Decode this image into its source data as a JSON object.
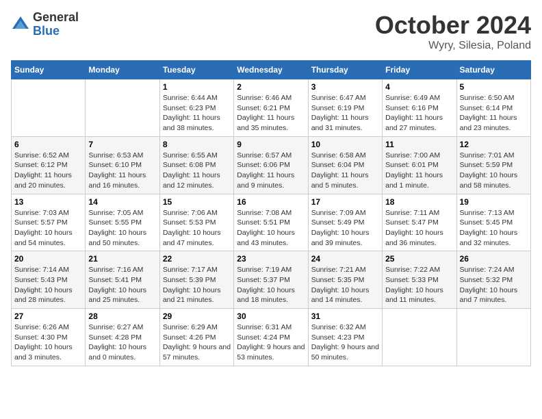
{
  "header": {
    "logo_general": "General",
    "logo_blue": "Blue",
    "month_title": "October 2024",
    "location": "Wyry, Silesia, Poland"
  },
  "weekdays": [
    "Sunday",
    "Monday",
    "Tuesday",
    "Wednesday",
    "Thursday",
    "Friday",
    "Saturday"
  ],
  "weeks": [
    [
      {
        "day": "",
        "detail": ""
      },
      {
        "day": "",
        "detail": ""
      },
      {
        "day": "1",
        "detail": "Sunrise: 6:44 AM\nSunset: 6:23 PM\nDaylight: 11 hours\nand 38 minutes."
      },
      {
        "day": "2",
        "detail": "Sunrise: 6:46 AM\nSunset: 6:21 PM\nDaylight: 11 hours\nand 35 minutes."
      },
      {
        "day": "3",
        "detail": "Sunrise: 6:47 AM\nSunset: 6:19 PM\nDaylight: 11 hours\nand 31 minutes."
      },
      {
        "day": "4",
        "detail": "Sunrise: 6:49 AM\nSunset: 6:16 PM\nDaylight: 11 hours\nand 27 minutes."
      },
      {
        "day": "5",
        "detail": "Sunrise: 6:50 AM\nSunset: 6:14 PM\nDaylight: 11 hours\nand 23 minutes."
      }
    ],
    [
      {
        "day": "6",
        "detail": "Sunrise: 6:52 AM\nSunset: 6:12 PM\nDaylight: 11 hours\nand 20 minutes."
      },
      {
        "day": "7",
        "detail": "Sunrise: 6:53 AM\nSunset: 6:10 PM\nDaylight: 11 hours\nand 16 minutes."
      },
      {
        "day": "8",
        "detail": "Sunrise: 6:55 AM\nSunset: 6:08 PM\nDaylight: 11 hours\nand 12 minutes."
      },
      {
        "day": "9",
        "detail": "Sunrise: 6:57 AM\nSunset: 6:06 PM\nDaylight: 11 hours\nand 9 minutes."
      },
      {
        "day": "10",
        "detail": "Sunrise: 6:58 AM\nSunset: 6:04 PM\nDaylight: 11 hours\nand 5 minutes."
      },
      {
        "day": "11",
        "detail": "Sunrise: 7:00 AM\nSunset: 6:01 PM\nDaylight: 11 hours\nand 1 minute."
      },
      {
        "day": "12",
        "detail": "Sunrise: 7:01 AM\nSunset: 5:59 PM\nDaylight: 10 hours\nand 58 minutes."
      }
    ],
    [
      {
        "day": "13",
        "detail": "Sunrise: 7:03 AM\nSunset: 5:57 PM\nDaylight: 10 hours\nand 54 minutes."
      },
      {
        "day": "14",
        "detail": "Sunrise: 7:05 AM\nSunset: 5:55 PM\nDaylight: 10 hours\nand 50 minutes."
      },
      {
        "day": "15",
        "detail": "Sunrise: 7:06 AM\nSunset: 5:53 PM\nDaylight: 10 hours\nand 47 minutes."
      },
      {
        "day": "16",
        "detail": "Sunrise: 7:08 AM\nSunset: 5:51 PM\nDaylight: 10 hours\nand 43 minutes."
      },
      {
        "day": "17",
        "detail": "Sunrise: 7:09 AM\nSunset: 5:49 PM\nDaylight: 10 hours\nand 39 minutes."
      },
      {
        "day": "18",
        "detail": "Sunrise: 7:11 AM\nSunset: 5:47 PM\nDaylight: 10 hours\nand 36 minutes."
      },
      {
        "day": "19",
        "detail": "Sunrise: 7:13 AM\nSunset: 5:45 PM\nDaylight: 10 hours\nand 32 minutes."
      }
    ],
    [
      {
        "day": "20",
        "detail": "Sunrise: 7:14 AM\nSunset: 5:43 PM\nDaylight: 10 hours\nand 28 minutes."
      },
      {
        "day": "21",
        "detail": "Sunrise: 7:16 AM\nSunset: 5:41 PM\nDaylight: 10 hours\nand 25 minutes."
      },
      {
        "day": "22",
        "detail": "Sunrise: 7:17 AM\nSunset: 5:39 PM\nDaylight: 10 hours\nand 21 minutes."
      },
      {
        "day": "23",
        "detail": "Sunrise: 7:19 AM\nSunset: 5:37 PM\nDaylight: 10 hours\nand 18 minutes."
      },
      {
        "day": "24",
        "detail": "Sunrise: 7:21 AM\nSunset: 5:35 PM\nDaylight: 10 hours\nand 14 minutes."
      },
      {
        "day": "25",
        "detail": "Sunrise: 7:22 AM\nSunset: 5:33 PM\nDaylight: 10 hours\nand 11 minutes."
      },
      {
        "day": "26",
        "detail": "Sunrise: 7:24 AM\nSunset: 5:32 PM\nDaylight: 10 hours\nand 7 minutes."
      }
    ],
    [
      {
        "day": "27",
        "detail": "Sunrise: 6:26 AM\nSunset: 4:30 PM\nDaylight: 10 hours\nand 3 minutes."
      },
      {
        "day": "28",
        "detail": "Sunrise: 6:27 AM\nSunset: 4:28 PM\nDaylight: 10 hours\nand 0 minutes."
      },
      {
        "day": "29",
        "detail": "Sunrise: 6:29 AM\nSunset: 4:26 PM\nDaylight: 9 hours\nand 57 minutes."
      },
      {
        "day": "30",
        "detail": "Sunrise: 6:31 AM\nSunset: 4:24 PM\nDaylight: 9 hours\nand 53 minutes."
      },
      {
        "day": "31",
        "detail": "Sunrise: 6:32 AM\nSunset: 4:23 PM\nDaylight: 9 hours\nand 50 minutes."
      },
      {
        "day": "",
        "detail": ""
      },
      {
        "day": "",
        "detail": ""
      }
    ]
  ]
}
